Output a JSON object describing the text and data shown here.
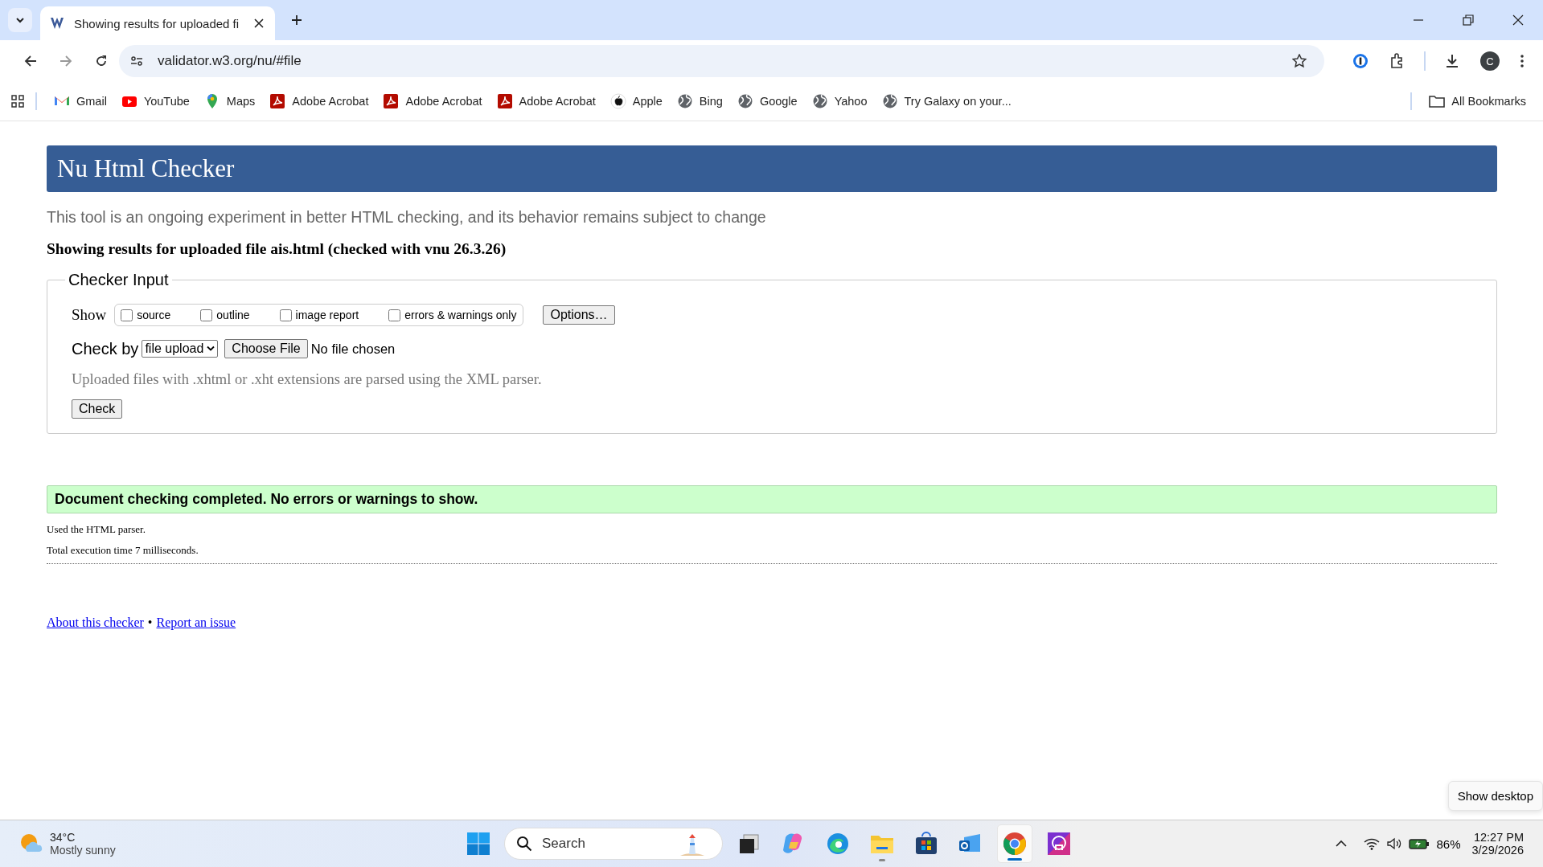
{
  "browser": {
    "tabs": [
      {
        "title": "Showing results for uploaded fi",
        "selected": true
      }
    ],
    "address": "validator.w3.org/nu/#file",
    "profile_initial": "C",
    "bookmarks": [
      {
        "label": "Gmail",
        "kind": "gmail"
      },
      {
        "label": "YouTube",
        "kind": "youtube"
      },
      {
        "label": "Maps",
        "kind": "maps"
      },
      {
        "label": "Adobe Acrobat",
        "kind": "acrobat"
      },
      {
        "label": "Adobe Acrobat",
        "kind": "acrobat"
      },
      {
        "label": "Adobe Acrobat",
        "kind": "acrobat"
      },
      {
        "label": "Apple",
        "kind": "apple"
      },
      {
        "label": "Bing",
        "kind": "globe"
      },
      {
        "label": "Google",
        "kind": "globe"
      },
      {
        "label": "Yahoo",
        "kind": "globe"
      },
      {
        "label": "Try Galaxy on your...",
        "kind": "globe"
      }
    ],
    "all_bookmarks": "All Bookmarks"
  },
  "page": {
    "title": "Nu Html Checker",
    "intro": "This tool is an ongoing experiment in better HTML checking, and its behavior remains subject to change",
    "results_heading": "Showing results for uploaded file ais.html (checked with vnu 26.3.26)",
    "checker_input": {
      "legend": "Checker Input",
      "show_label": "Show",
      "options": [
        {
          "label": "source",
          "checked": false
        },
        {
          "label": "outline",
          "checked": false
        },
        {
          "label": "image report",
          "checked": false
        },
        {
          "label": "errors & warnings only",
          "checked": false
        }
      ],
      "options_button": "Options…",
      "check_by_label": "Check by",
      "check_by_value": "file upload",
      "choose_file_button": "Choose File",
      "file_status": "No file chosen",
      "note": "Uploaded files with .xhtml or .xht extensions are parsed using the XML parser.",
      "check_button": "Check"
    },
    "success_message": "Document checking completed. No errors or warnings to show.",
    "details": [
      "Used the HTML parser.",
      "Total execution time 7 milliseconds."
    ],
    "footer_links": [
      "About this checker",
      "Report an issue"
    ],
    "footer_separator": "•"
  },
  "tooltip": "Show desktop",
  "taskbar": {
    "weather": {
      "temperature": "34°C",
      "condition": "Mostly sunny"
    },
    "search_placeholder": "Search",
    "apps": [
      {
        "kind": "taskview",
        "open": false,
        "active": false
      },
      {
        "kind": "copilot",
        "open": false,
        "active": false
      },
      {
        "kind": "edge",
        "open": false,
        "active": false
      },
      {
        "kind": "explorer",
        "open": true,
        "active": false
      },
      {
        "kind": "store",
        "open": false,
        "active": false
      },
      {
        "kind": "outlook",
        "open": false,
        "active": false
      },
      {
        "kind": "chrome",
        "open": true,
        "active": true
      },
      {
        "kind": "app",
        "open": false,
        "active": false
      }
    ],
    "battery": "86%",
    "time": "12:27 PM",
    "date": "3/29/2026"
  }
}
